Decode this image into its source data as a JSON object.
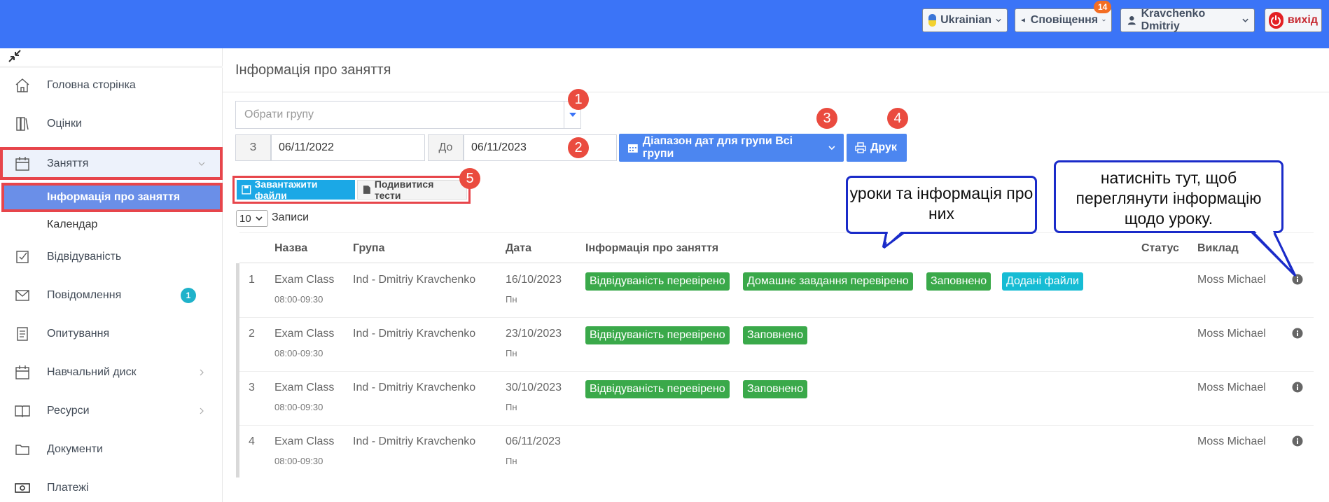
{
  "topbar": {
    "language": "Ukrainian",
    "notifications_label": "Сповіщення",
    "notifications_count": "14",
    "user_name": "Kravchenko Dmitriy",
    "logout_label": "вихід"
  },
  "sidebar": {
    "items": [
      {
        "label": "Головна сторінка",
        "icon": "home-icon"
      },
      {
        "label": "Оцінки",
        "icon": "grades-icon"
      },
      {
        "label": "Заняття",
        "icon": "calendar-icon"
      },
      {
        "label": "Відвідуваність",
        "icon": "checkbox-icon"
      },
      {
        "label": "Повідомлення",
        "icon": "envelope-icon",
        "badge": "1"
      },
      {
        "label": "Опитування",
        "icon": "survey-icon"
      },
      {
        "label": "Навчальний диск",
        "icon": "disk-icon"
      },
      {
        "label": "Ресурси",
        "icon": "book-icon"
      },
      {
        "label": "Документи",
        "icon": "folder-icon"
      },
      {
        "label": "Платежі",
        "icon": "money-icon"
      }
    ],
    "sub_items": [
      "Інформація про заняття",
      "Календар"
    ]
  },
  "main": {
    "title": "Інформація про заняття",
    "group_placeholder": "Обрати групу",
    "from_label": "З",
    "from_date": "06/11/2022",
    "to_label": "До",
    "to_date": "06/11/2023",
    "range_button": "Діапазон дат для групи Всі групи",
    "print_button": "Друк",
    "upload_button": "Завантажити файли",
    "tests_button": "Подивитися тести",
    "page_length": "10",
    "records_label": "Записи"
  },
  "table": {
    "headers": {
      "name": "Назва",
      "group": "Група",
      "date": "Дата",
      "info": "Інформація про заняття",
      "status": "Статус",
      "teacher": "Виклад"
    },
    "rows": [
      {
        "n": "1",
        "name": "Exam Class",
        "time": "08:00-09:30",
        "group": "Ind - Dmitriy Kravchenko",
        "date": "16/10/2023",
        "day": "Пн",
        "tags": [
          "Відвідуваність перевірено",
          "Домашнє завдання перевірено",
          "Заповнено",
          "Додані файли"
        ],
        "teacher": "Moss Michael"
      },
      {
        "n": "2",
        "name": "Exam Class",
        "time": "08:00-09:30",
        "group": "Ind - Dmitriy Kravchenko",
        "date": "23/10/2023",
        "day": "Пн",
        "tags": [
          "Відвідуваність перевірено",
          "Заповнено"
        ],
        "teacher": "Moss Michael"
      },
      {
        "n": "3",
        "name": "Exam Class",
        "time": "08:00-09:30",
        "group": "Ind - Dmitriy Kravchenko",
        "date": "30/10/2023",
        "day": "Пн",
        "tags": [
          "Відвідуваність перевірено",
          "Заповнено"
        ],
        "teacher": "Moss Michael"
      },
      {
        "n": "4",
        "name": "Exam Class",
        "time": "08:00-09:30",
        "group": "Ind - Dmitriy Kravchenko",
        "date": "06/11/2023",
        "day": "Пн",
        "tags": [],
        "teacher": "Moss Michael"
      }
    ]
  },
  "annotations": {
    "markers": [
      "1",
      "2",
      "3",
      "4",
      "5"
    ],
    "callout_lessons": "уроки та інформація про них",
    "callout_click": "натисніть тут, щоб переглянути інформацію щодо уроку."
  },
  "colors": {
    "topbar": "#3b74f7",
    "accent_red": "#e7454b",
    "tag_green": "#3aa94a",
    "tag_cyan": "#16bcd4",
    "callout_border": "#1a2bc9"
  }
}
